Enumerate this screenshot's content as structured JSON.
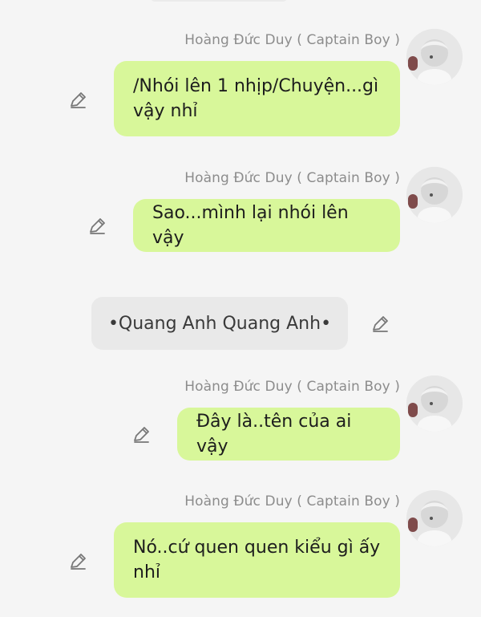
{
  "messages": [
    {
      "sender": "Hoàng Đức Duy ( Captain Boy )",
      "text": "/Nhói lên 1 nhịp/Chuyện...gì vậy nhỉ"
    },
    {
      "sender": "Hoàng Đức Duy ( Captain Boy )",
      "text": "Sao...mình lại nhói lên vậy"
    },
    {
      "sender": "Hoàng Đức Duy ( Captain Boy )",
      "text": "Đây là..tên của ai vậy"
    },
    {
      "sender": "Hoàng Đức Duy ( Captain Boy )",
      "text": "Nó..cứ quen quen kiểu gì ấy nhỉ"
    }
  ],
  "system_message": {
    "text": "•Quang Anh Quang Anh•"
  },
  "colors": {
    "background": "#f5f5f5",
    "bubble": "#d8f79a",
    "system_bubble": "#e9e9e9",
    "sender_text": "#8c8c8c",
    "icon": "#777777"
  },
  "icons": {
    "avatar": "avatar",
    "edit": "edit-icon"
  }
}
